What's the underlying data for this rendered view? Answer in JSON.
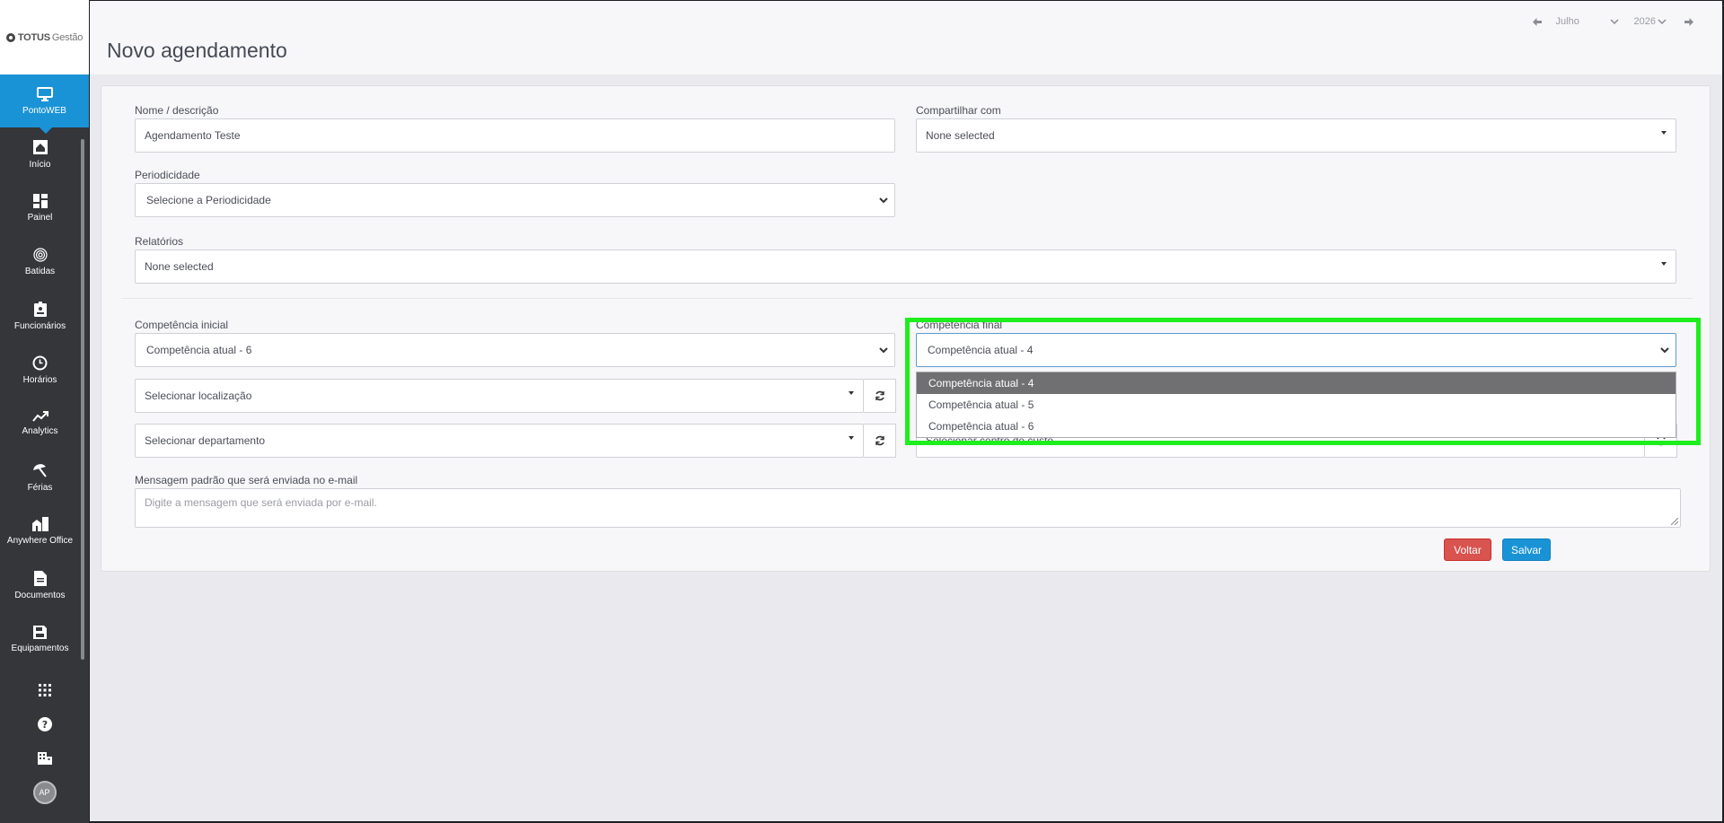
{
  "brand": {
    "name": "TOTUS",
    "sub": "Gestão"
  },
  "app": {
    "label": "PontoWEB"
  },
  "nav": {
    "items": [
      {
        "label": "Início",
        "icon": "home-icon"
      },
      {
        "label": "Painel",
        "icon": "dashboard-icon"
      },
      {
        "label": "Batidas",
        "icon": "fingerprint-icon"
      },
      {
        "label": "Funcionários",
        "icon": "id-badge-icon"
      },
      {
        "label": "Horários",
        "icon": "clock-icon"
      },
      {
        "label": "Analytics",
        "icon": "trending-up-icon"
      },
      {
        "label": "Férias",
        "icon": "beach-umbrella-icon"
      },
      {
        "label": "Anywhere Office",
        "icon": "buildings-icon"
      },
      {
        "label": "Documentos",
        "icon": "document-icon"
      },
      {
        "label": "Equipamentos",
        "icon": "device-save-icon"
      }
    ]
  },
  "user": {
    "initials": "AP"
  },
  "header": {
    "title": "Novo agendamento",
    "month": "Julho",
    "year": "2026"
  },
  "form": {
    "nome_label": "Nome / descrição",
    "nome_value": "Agendamento Teste",
    "compartilhar_label": "Compartilhar com",
    "compartilhar_value": "None selected",
    "periodicidade_label": "Periodicidade",
    "periodicidade_value": "Selecione a Periodicidade",
    "relatorios_label": "Relatórios",
    "relatorios_value": "None selected",
    "comp_inicial_label": "Competência inicial",
    "comp_inicial_value": "Competência atual - 6",
    "comp_final_label": "Competência final",
    "comp_final_value": "Competência atual - 4",
    "comp_final_options": [
      "Competência atual - 4",
      "Competência atual - 5",
      "Competência atual - 6"
    ],
    "localizacao_value": "Selecionar localização",
    "departamento_value": "Selecionar departamento",
    "centro_custo_value": "Selecionar centro de custo",
    "mensagem_label": "Mensagem padrão que será enviada no e-mail",
    "mensagem_placeholder": "Digite a mensagem que será enviada por e-mail.",
    "voltar_label": "Voltar",
    "salvar_label": "Salvar"
  },
  "colors": {
    "accent": "#1a93d6",
    "danger": "#d9534f",
    "highlight": "#1dee1d",
    "sidebar": "#35363a"
  }
}
